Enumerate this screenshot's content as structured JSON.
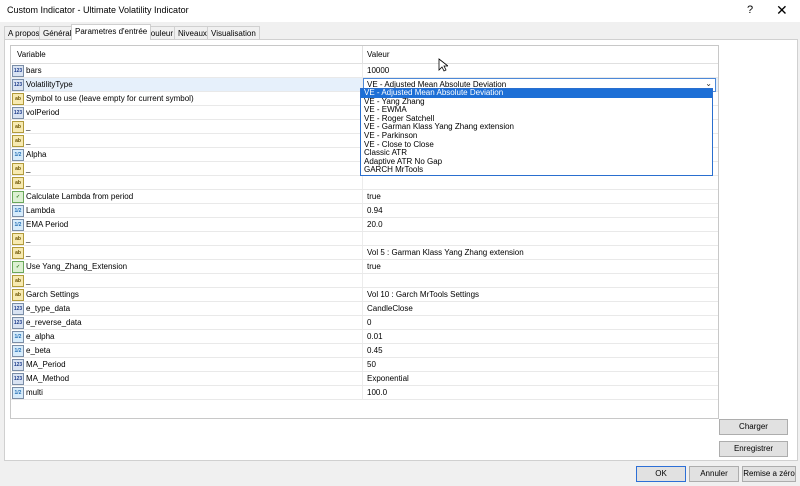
{
  "window": {
    "title": "Custom Indicator - Ultimate Volatility Indicator",
    "help": "?",
    "close": "✕"
  },
  "tabs": [
    "A propos",
    "Général",
    "Parametres d'entrée",
    "Couleur",
    "Niveaux",
    "Visualisation"
  ],
  "active_tab": "Parametres d'entrée",
  "grid": {
    "header_variable": "Variable",
    "header_value": "Valeur",
    "rows": [
      {
        "type": "int",
        "icon_text": "123",
        "name": "bars",
        "value": "10000"
      },
      {
        "type": "enm",
        "icon_text": "123",
        "name": "VolatilityType",
        "value": "VE - Adjusted Mean Absolute Deviation"
      },
      {
        "type": "str",
        "icon_text": "ab",
        "name": "Symbol to use (leave empty for current symbol)",
        "value": ""
      },
      {
        "type": "int",
        "icon_text": "123",
        "name": "volPeriod",
        "value": ""
      },
      {
        "type": "str",
        "icon_text": "ab",
        "name": "_",
        "value": ""
      },
      {
        "type": "str",
        "icon_text": "ab",
        "name": "_",
        "value": ""
      },
      {
        "type": "dbl",
        "icon_text": "1/2",
        "name": "Alpha",
        "value": ""
      },
      {
        "type": "str",
        "icon_text": "ab",
        "name": "_",
        "value": ""
      },
      {
        "type": "str",
        "icon_text": "ab",
        "name": "_",
        "value": ""
      },
      {
        "type": "bool",
        "icon_text": "✓",
        "name": "Calculate Lambda from period",
        "value": "true"
      },
      {
        "type": "dbl",
        "icon_text": "1/2",
        "name": "Lambda",
        "value": "0.94"
      },
      {
        "type": "dbl",
        "icon_text": "1/2",
        "name": "EMA Period",
        "value": "20.0"
      },
      {
        "type": "str",
        "icon_text": "ab",
        "name": "_",
        "value": ""
      },
      {
        "type": "str",
        "icon_text": "ab",
        "name": "_",
        "value": "Vol 5 : Garman Klass Yang Zhang extension"
      },
      {
        "type": "bool",
        "icon_text": "✓",
        "name": "Use Yang_Zhang_Extension",
        "value": "true"
      },
      {
        "type": "str",
        "icon_text": "ab",
        "name": "_",
        "value": ""
      },
      {
        "type": "str",
        "icon_text": "ab",
        "name": "Garch Settings",
        "value": "Vol 10 : Garch MrTools Settings"
      },
      {
        "type": "enm",
        "icon_text": "123",
        "name": "e_type_data",
        "value": "CandleClose"
      },
      {
        "type": "int",
        "icon_text": "123",
        "name": "e_reverse_data",
        "value": "0"
      },
      {
        "type": "dbl",
        "icon_text": "1/2",
        "name": "e_alpha",
        "value": "0.01"
      },
      {
        "type": "dbl",
        "icon_text": "1/2",
        "name": "e_beta",
        "value": "0.45"
      },
      {
        "type": "int",
        "icon_text": "123",
        "name": "MA_Period",
        "value": "50"
      },
      {
        "type": "enm",
        "icon_text": "123",
        "name": "MA_Method",
        "value": "Exponential"
      },
      {
        "type": "dbl",
        "icon_text": "1/2",
        "name": "multi",
        "value": "100.0"
      }
    ]
  },
  "dropdown": {
    "selected": "VE - Adjusted Mean Absolute Deviation",
    "options": [
      "VE - Adjusted Mean Absolute Deviation",
      "VE - Yang Zhang",
      "VE - EWMA",
      "VE - Roger Satchell",
      "VE - Garman Klass Yang Zhang extension",
      "VE - Parkinson",
      "VE - Close to Close",
      "Classic ATR",
      "Adaptive ATR No Gap",
      "GARCH MrTools"
    ]
  },
  "buttons": {
    "load": "Charger",
    "save": "Enregistrer",
    "ok": "OK",
    "cancel": "Annuler",
    "reset": "Remise a zéro"
  },
  "colors": {
    "selection": "#1d6fd6",
    "highlight_row": "#e6f0fb",
    "combo_border": "#4d89d8"
  }
}
